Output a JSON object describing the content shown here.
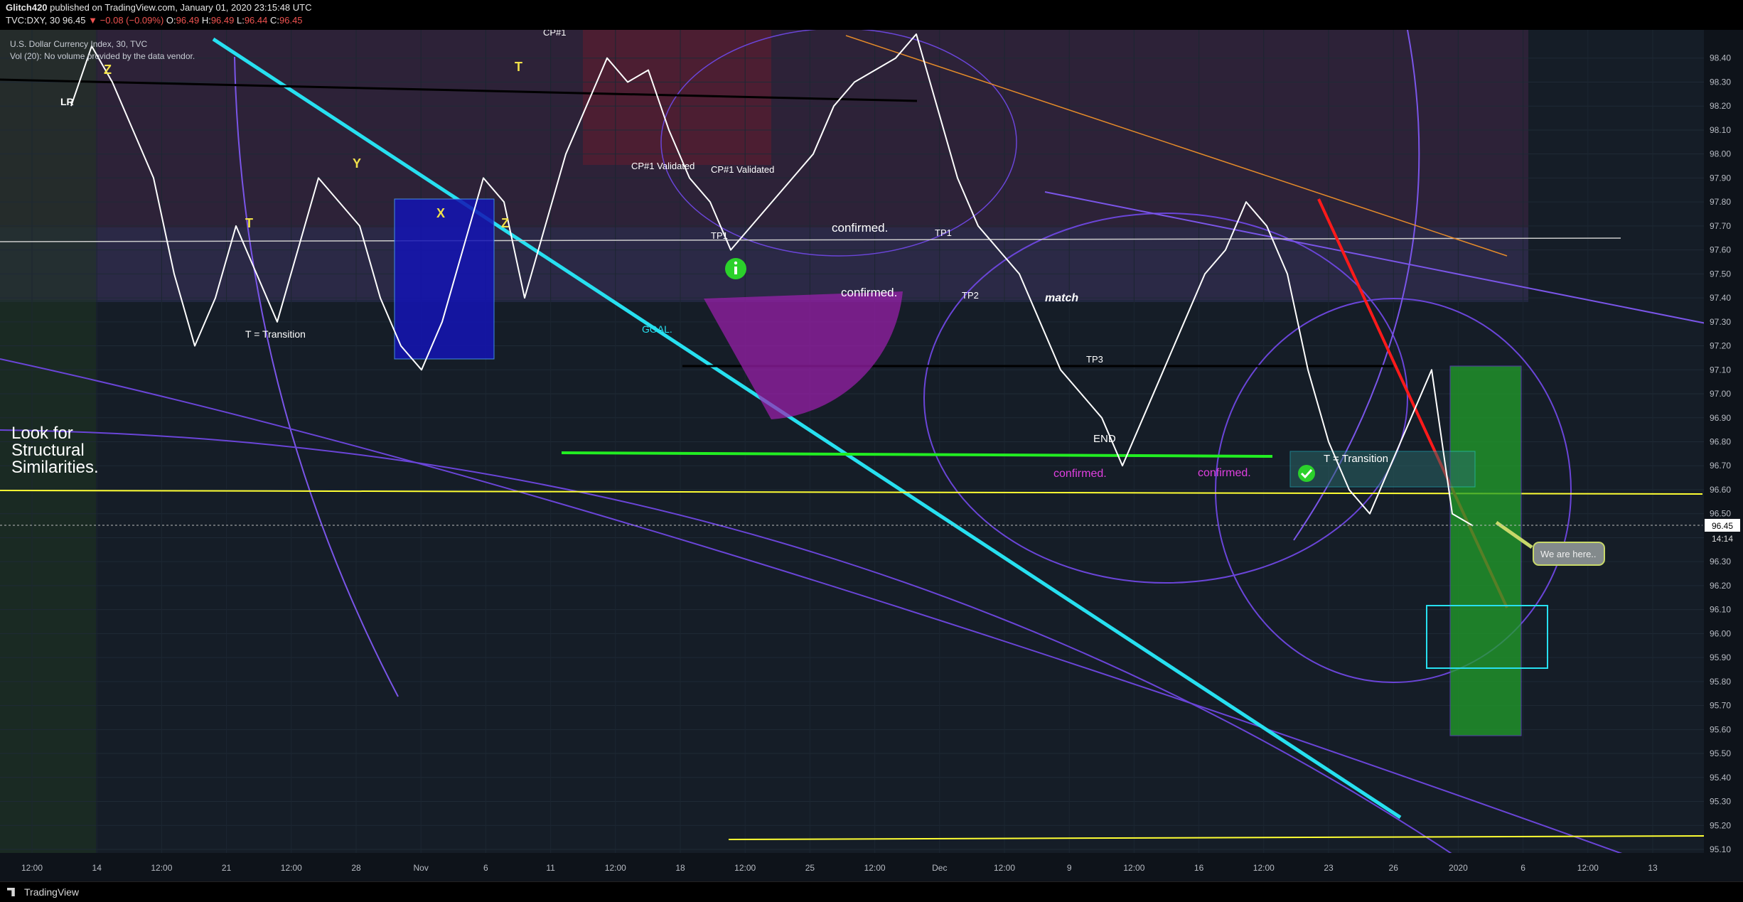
{
  "header": {
    "author": "Glitch420",
    "published_text": "published on TradingView.com, January 01, 2020 23:15:48 UTC",
    "symbol_line_prefix": "TVC:DXY, 30",
    "last": "96.45",
    "change": "−0.08 (−0.09%)",
    "o_label": "O:",
    "o_value": "96.49",
    "h_label": "H:",
    "h_value": "96.49",
    "l_label": "L:",
    "l_value": "96.44",
    "c_label": "C:",
    "c_value": "96.45"
  },
  "legend": {
    "title": "U.S. Dollar Currency Index, 30, TVC",
    "volume_note": "Vol (20): No volume provided by the data vendor."
  },
  "note_text": "Look for\nStructural\nSimilarities.",
  "footer": {
    "brand": "TradingView"
  },
  "colors": {
    "background": "#151d27",
    "price_line": "#ffffff",
    "cyan_trend": "#27e0f0",
    "yellow_line": "#ffff33",
    "green_line": "#22ee22",
    "red_line": "#ff1a1a",
    "purple_arc": "#7a55e8"
  },
  "chart_data": {
    "type": "line",
    "title": "U.S. Dollar Currency Index",
    "interval": "30",
    "ylim": [
      95.1,
      98.5
    ],
    "y_ticks": [
      "98.40",
      "98.30",
      "98.20",
      "98.10",
      "98.00",
      "97.90",
      "97.80",
      "97.70",
      "97.60",
      "97.50",
      "97.40",
      "97.30",
      "97.20",
      "97.10",
      "97.00",
      "96.90",
      "96.80",
      "96.70",
      "96.60",
      "96.50",
      "96.40",
      "96.30",
      "96.20",
      "96.10",
      "96.00",
      "95.90",
      "95.80",
      "95.70",
      "95.60",
      "95.50",
      "95.40",
      "95.30",
      "95.20",
      "95.10"
    ],
    "x_ticks": [
      "12:00",
      "14",
      "12:00",
      "21",
      "12:00",
      "28",
      "Nov",
      "6",
      "11",
      "12:00",
      "18",
      "12:00",
      "25",
      "12:00",
      "Dec",
      "12:00",
      "9",
      "12:00",
      "16",
      "12:00",
      "23",
      "26",
      "2020",
      "6",
      "12:00",
      "13"
    ],
    "current_price": "96.45",
    "countdown": "14:14",
    "series": [
      {
        "values": [
          98.2,
          98.45,
          98.3,
          98.1,
          97.9,
          97.5,
          97.2,
          97.4,
          97.7,
          97.5,
          97.3,
          97.6,
          97.9,
          97.8,
          97.7,
          97.4,
          97.2,
          97.1,
          97.3,
          97.6,
          97.9,
          97.8,
          97.4,
          97.7,
          98.0,
          98.2,
          98.4,
          98.3,
          98.35,
          98.1,
          97.9,
          97.8,
          97.6,
          97.7,
          97.8,
          97.9,
          98.0,
          98.2,
          98.3,
          98.35,
          98.4,
          98.5,
          98.2,
          97.9,
          97.7,
          97.6,
          97.5,
          97.3,
          97.1,
          97.0,
          96.9,
          96.7,
          96.9,
          97.1,
          97.3,
          97.5,
          97.6,
          97.8,
          97.7,
          97.5,
          97.1,
          96.8,
          96.6,
          96.5,
          96.7,
          96.9,
          97.1,
          96.5,
          96.45
        ]
      }
    ],
    "annotations": [
      "LR",
      "Z",
      "T",
      "Y",
      "X",
      "Z",
      "T",
      "T = Transition",
      "CP#1",
      "CP#1 Validated",
      "CP#1 Validated",
      "TP1",
      "TP1",
      "TP2",
      "TP3",
      "GOAL.",
      "confirmed.",
      "confirmed.",
      "match",
      "END",
      "confirmed.",
      "confirmed.",
      "T = Transition",
      "We are here.."
    ]
  }
}
